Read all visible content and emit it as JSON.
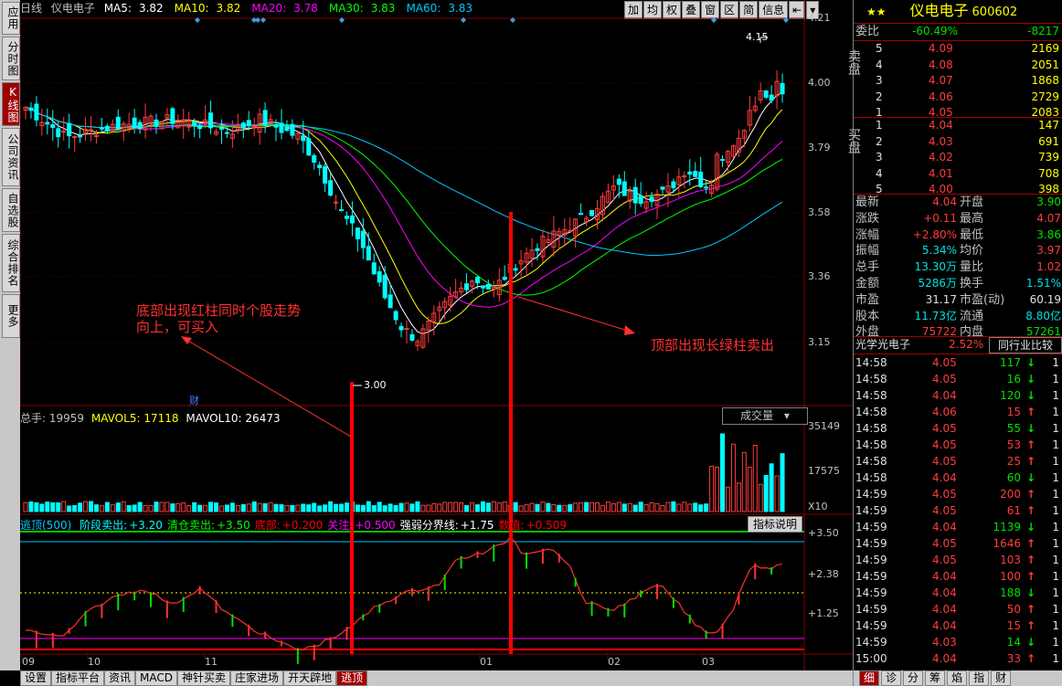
{
  "left_tabs": [
    "应用",
    "分时图",
    "K线图",
    "公司资讯",
    "自选股",
    "综合排名",
    "更多"
  ],
  "header": {
    "period": "日线",
    "stock": "仪电电子",
    "ma": [
      {
        "label": "MA5:",
        "value": "3.82",
        "color": "#ffffff"
      },
      {
        "label": "MA10:",
        "value": "3.82",
        "color": "#ffff00"
      },
      {
        "label": "MA20:",
        "value": "3.78",
        "color": "#ff00ff"
      },
      {
        "label": "MA30:",
        "value": "3.83",
        "color": "#00ff00"
      },
      {
        "label": "MA60:",
        "value": "3.83",
        "color": "#00c8ff"
      }
    ]
  },
  "toolbar": [
    "加",
    "均",
    "权",
    "叠",
    "窗",
    "区",
    "简",
    "信息",
    "⇤",
    "▾"
  ],
  "price_axis": [
    "4.21",
    "4.00",
    "3.79",
    "3.58",
    "3.36",
    "3.15"
  ],
  "high_mark": "4.15",
  "low_mark": "3.00",
  "cai": "财",
  "annotations": {
    "buy": "底部出现红柱同时个股走势向上，可买入",
    "buy_line1": "底部出现红柱同时个股走势",
    "buy_line2": "向上，可买入",
    "sell": "顶部出现长绿柱卖出"
  },
  "volume": {
    "label": "总手:",
    "value": "19959",
    "mavol5_label": "MAVOL5:",
    "mavol5": "17118",
    "mavol10_label": "MAVOL10:",
    "mavol10": "26473",
    "select": "成交量",
    "axis": [
      "35149",
      "17575"
    ],
    "unit": "X10"
  },
  "indicator": {
    "title": "逃顶(500)",
    "items": [
      {
        "label": "阶段卖出:",
        "value": "+3.20",
        "color": "#00ffff"
      },
      {
        "label": "清仓卖出:",
        "value": "+3.50",
        "color": "#00ff00"
      },
      {
        "label": "底部:",
        "value": "+0.200",
        "color": "#ff0000"
      },
      {
        "label": "关注:",
        "value": "+0.500",
        "color": "#ff00ff"
      },
      {
        "label": "强弱分界线:",
        "value": "+1.75",
        "color": "#ffffff"
      },
      {
        "label": "数值:",
        "value": "+0.509",
        "color": "#ff0000"
      }
    ],
    "explain_btn": "指标说明",
    "axis": [
      "+3.50",
      "+2.38",
      "+1.25"
    ]
  },
  "date_axis": [
    "09",
    "10",
    "11",
    "01",
    "02",
    "03"
  ],
  "bottom_tabs": [
    "设置",
    "指标平台",
    "资讯",
    "MACD",
    "神针买卖",
    "庄家进场",
    "开天辟地",
    "逃顶"
  ],
  "quote": {
    "name": "仪电电子",
    "code": "600602",
    "wb_label": "委比",
    "wb": "-60.49%",
    "wc": "-8217",
    "sell_label": "卖盘",
    "sells": [
      {
        "n": "5",
        "p": "4.09",
        "v": "2169"
      },
      {
        "n": "4",
        "p": "4.08",
        "v": "2051"
      },
      {
        "n": "3",
        "p": "4.07",
        "v": "1868"
      },
      {
        "n": "2",
        "p": "4.06",
        "v": "2729"
      },
      {
        "n": "1",
        "p": "4.05",
        "v": "2083"
      }
    ],
    "buy_label": "买盘",
    "buys": [
      {
        "n": "1",
        "p": "4.04",
        "v": "147"
      },
      {
        "n": "2",
        "p": "4.03",
        "v": "691"
      },
      {
        "n": "3",
        "p": "4.02",
        "v": "739"
      },
      {
        "n": "4",
        "p": "4.01",
        "v": "708"
      },
      {
        "n": "5",
        "p": "4.00",
        "v": "398"
      }
    ],
    "stats": [
      {
        "l": "最新",
        "v": "4.04",
        "l2": "开盘",
        "v2": "3.90",
        "c": "red",
        "c2": "grn"
      },
      {
        "l": "涨跌",
        "v": "+0.11",
        "l2": "最高",
        "v2": "4.07",
        "c": "red",
        "c2": "red"
      },
      {
        "l": "涨幅",
        "v": "+2.80%",
        "l2": "最低",
        "v2": "3.86",
        "c": "red",
        "c2": "grn"
      },
      {
        "l": "振幅",
        "v": "5.34%",
        "l2": "均价",
        "v2": "3.97",
        "c": "cyn",
        "c2": "red"
      },
      {
        "l": "总手",
        "v": "13.30万",
        "l2": "量比",
        "v2": "1.02",
        "c": "cyn",
        "c2": "red"
      },
      {
        "l": "金额",
        "v": "5286万",
        "l2": "换手",
        "v2": "1.51%",
        "c": "cyn",
        "c2": "cyn"
      },
      {
        "l": "市盈",
        "v": "31.17",
        "l2": "市盈(动)",
        "v2": "60.19",
        "c": "wht",
        "c2": "wht"
      },
      {
        "l": "股本",
        "v": "11.73亿",
        "l2": "流通",
        "v2": "8.80亿",
        "c": "cyn",
        "c2": "cyn"
      },
      {
        "l": "外盘",
        "v": "75722",
        "l2": "内盘",
        "v2": "57261",
        "c": "red",
        "c2": "grn"
      }
    ],
    "sector": "光学光电子",
    "sector_pct": "2.52%",
    "compare_btn": "同行业比较",
    "ticks": [
      {
        "t": "14:58",
        "p": "4.05",
        "v": "117",
        "d": "down",
        "n": "1"
      },
      {
        "t": "14:58",
        "p": "4.05",
        "v": "16",
        "d": "down",
        "n": "1"
      },
      {
        "t": "14:58",
        "p": "4.04",
        "v": "120",
        "d": "down",
        "n": "1"
      },
      {
        "t": "14:58",
        "p": "4.06",
        "v": "15",
        "d": "up",
        "n": "1"
      },
      {
        "t": "14:58",
        "p": "4.05",
        "v": "55",
        "d": "down",
        "n": "1"
      },
      {
        "t": "14:58",
        "p": "4.05",
        "v": "53",
        "d": "up",
        "n": "1"
      },
      {
        "t": "14:58",
        "p": "4.05",
        "v": "25",
        "d": "up",
        "n": "1"
      },
      {
        "t": "14:58",
        "p": "4.04",
        "v": "60",
        "d": "down",
        "n": "1"
      },
      {
        "t": "14:59",
        "p": "4.05",
        "v": "200",
        "d": "up",
        "n": "1"
      },
      {
        "t": "14:59",
        "p": "4.05",
        "v": "61",
        "d": "up",
        "n": "1"
      },
      {
        "t": "14:59",
        "p": "4.04",
        "v": "1139",
        "d": "down",
        "n": "1"
      },
      {
        "t": "14:59",
        "p": "4.05",
        "v": "1646",
        "d": "up",
        "n": "1"
      },
      {
        "t": "14:59",
        "p": "4.05",
        "v": "103",
        "d": "up",
        "n": "1"
      },
      {
        "t": "14:59",
        "p": "4.04",
        "v": "100",
        "d": "up",
        "n": "1"
      },
      {
        "t": "14:59",
        "p": "4.04",
        "v": "188",
        "d": "down",
        "n": "1"
      },
      {
        "t": "14:59",
        "p": "4.04",
        "v": "50",
        "d": "up",
        "n": "1"
      },
      {
        "t": "14:59",
        "p": "4.04",
        "v": "15",
        "d": "up",
        "n": "1"
      },
      {
        "t": "14:59",
        "p": "4.03",
        "v": "14",
        "d": "down",
        "n": "1"
      },
      {
        "t": "15:00",
        "p": "4.04",
        "v": "33",
        "d": "up",
        "n": "1"
      }
    ],
    "bottom_tabs": [
      "细",
      "诊",
      "分",
      "筹",
      "焰",
      "指",
      "财"
    ]
  }
}
